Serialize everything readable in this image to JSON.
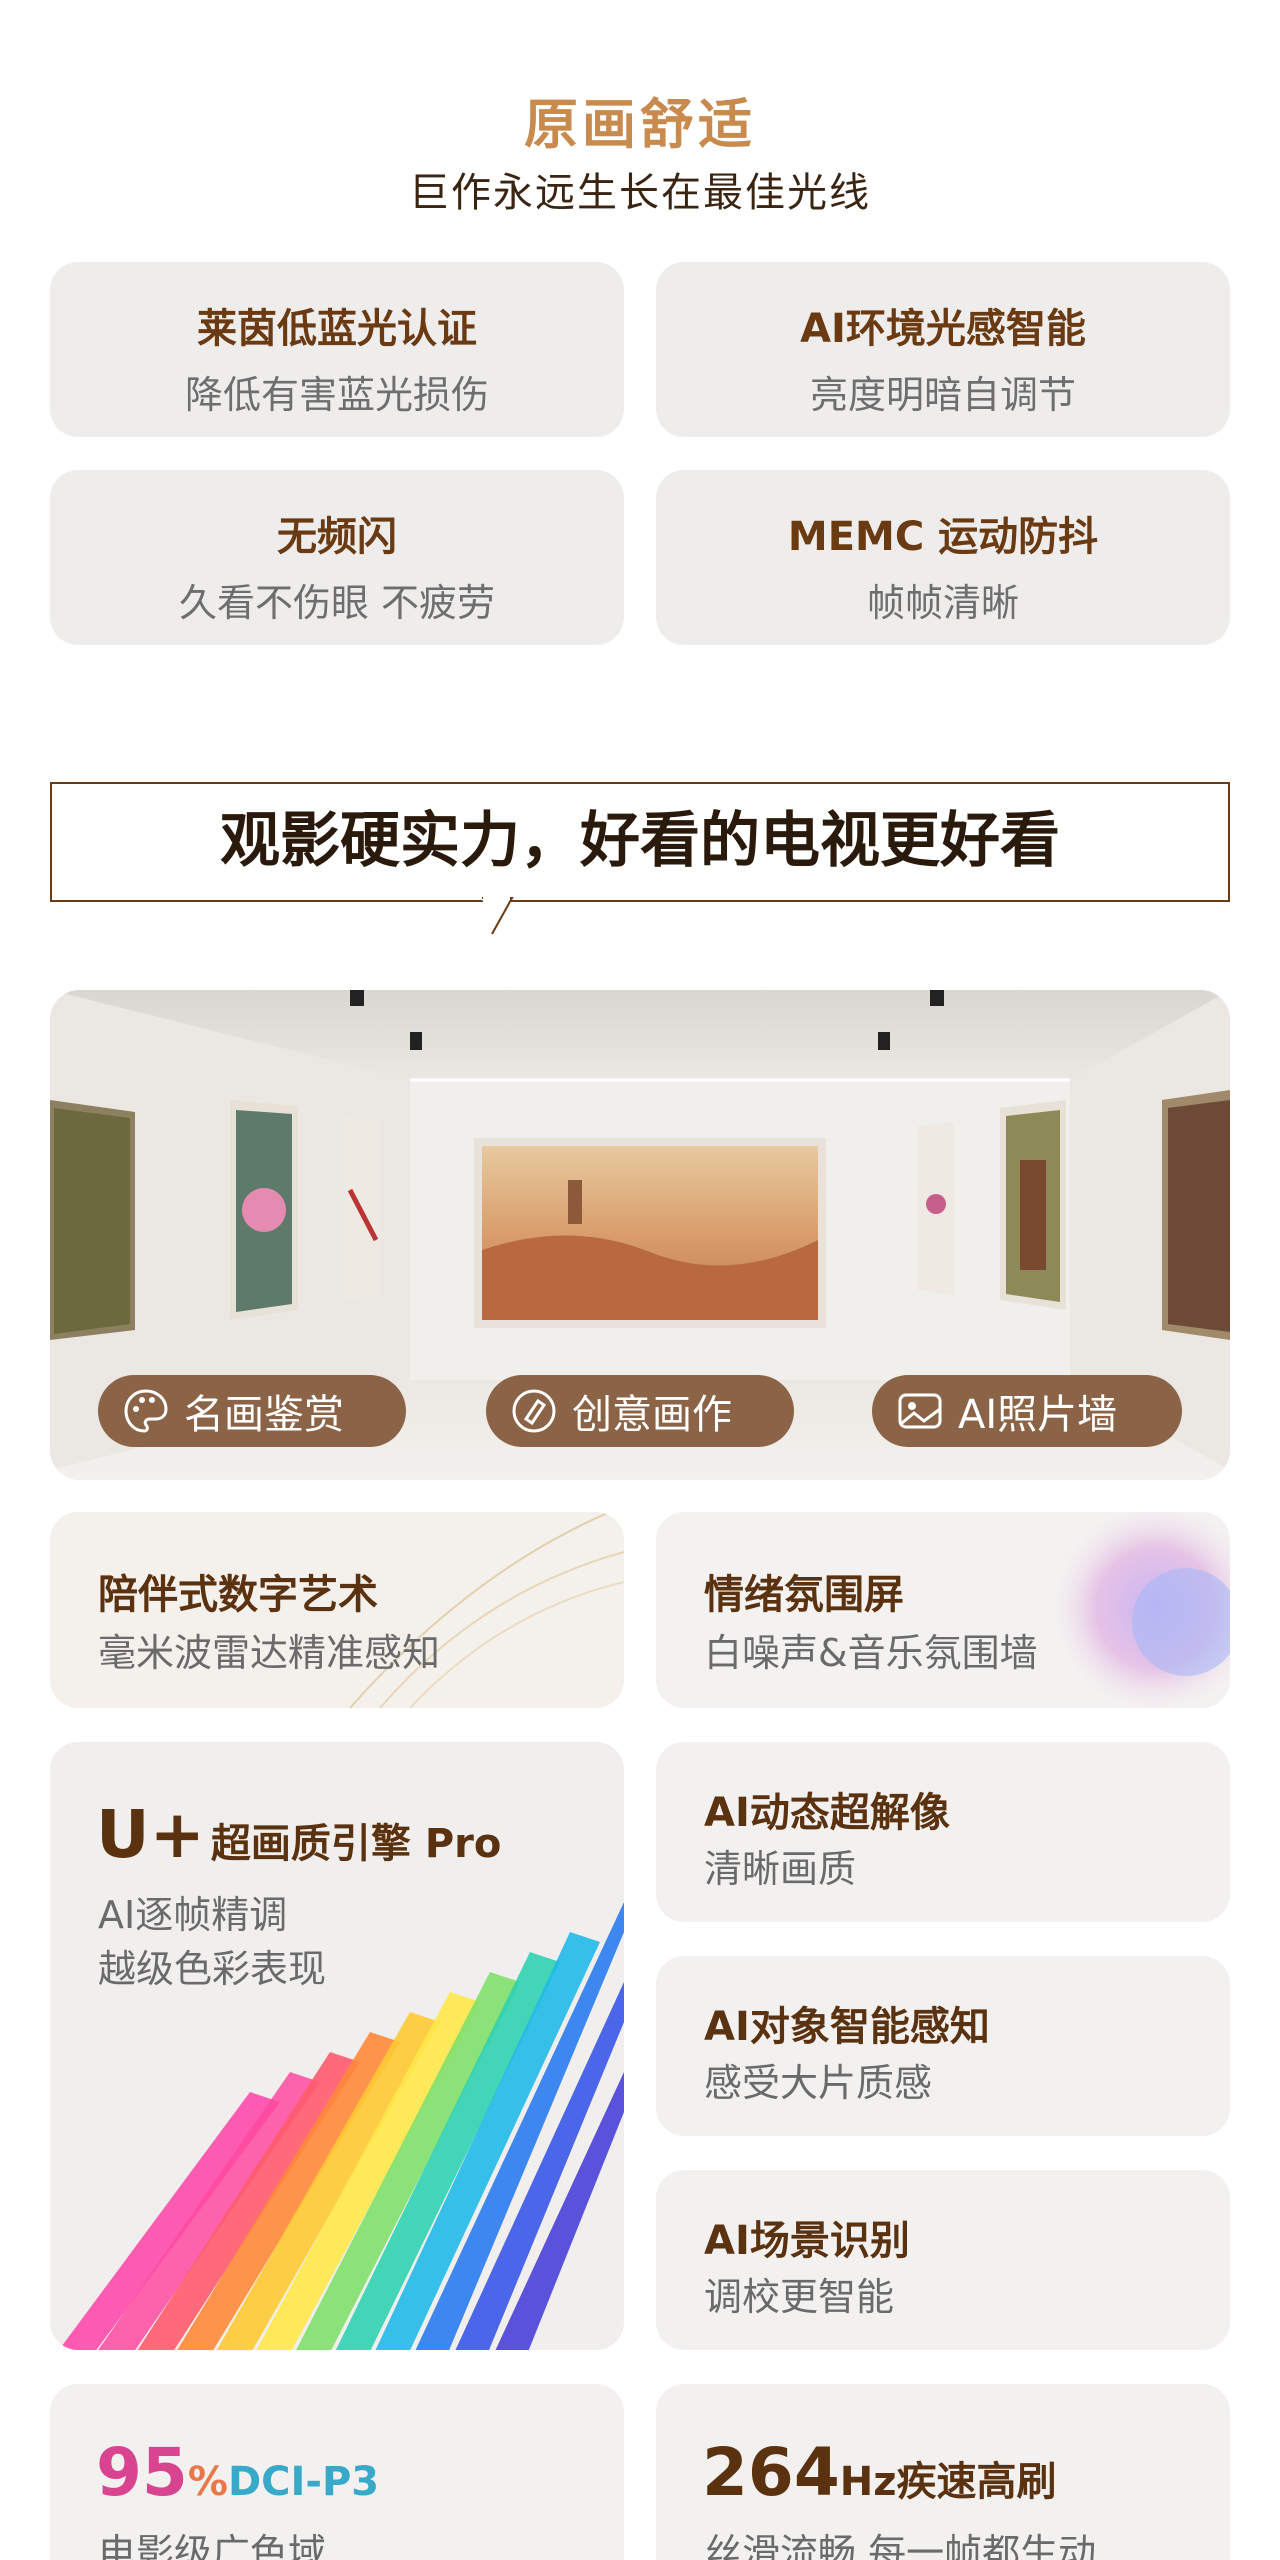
{
  "section1": {
    "title": "原画舒适",
    "subtitle": "巨作永远生长在最佳光线",
    "features": [
      {
        "title": "莱茵低蓝光认证",
        "desc": "降低有害蓝光损伤"
      },
      {
        "title": "AI环境光感智能",
        "desc": "亮度明暗自调节"
      },
      {
        "title": "无频闪",
        "desc": "久看不伤眼 不疲劳"
      },
      {
        "title": "MEMC 运动防抖",
        "desc": "帧帧清晰"
      }
    ]
  },
  "banner": {
    "text": "观影硬实力，好看的电视更好看"
  },
  "gallery": {
    "pills": [
      {
        "label": "名画鉴赏",
        "icon": "palette-icon"
      },
      {
        "label": "创意画作",
        "icon": "creative-brush-icon"
      },
      {
        "label": "AI照片墙",
        "icon": "photo-icon"
      }
    ]
  },
  "cards": {
    "digital_art": {
      "title": "陪伴式数字艺术",
      "desc": "毫米波雷达精准感知"
    },
    "ambience": {
      "title": "情绪氛围屏",
      "desc": "白噪声&音乐氛围墙"
    },
    "engine": {
      "brand": "U+",
      "title": "超画质引擎 Pro",
      "line1": "AI逐帧精调",
      "line2": "越级色彩表现"
    },
    "super_res": {
      "title": "AI动态超解像",
      "desc": "清晰画质"
    },
    "object": {
      "title": "AI对象智能感知",
      "desc": "感受大片质感"
    },
    "scene": {
      "title": "AI场景识别",
      "desc": "调校更智能"
    },
    "gamut": {
      "value": "95",
      "unit": "%",
      "label": "DCI-P3",
      "desc": "电影级广色域"
    },
    "refresh": {
      "value": "264",
      "unit": "Hz",
      "label": "疾速高刷",
      "desc": "丝滑流畅 每一帧都生动"
    }
  },
  "colors": {
    "accent": "#c98a4e",
    "brown": "#6a3a12",
    "pill": "#8b6448",
    "card": "#efedeb"
  }
}
